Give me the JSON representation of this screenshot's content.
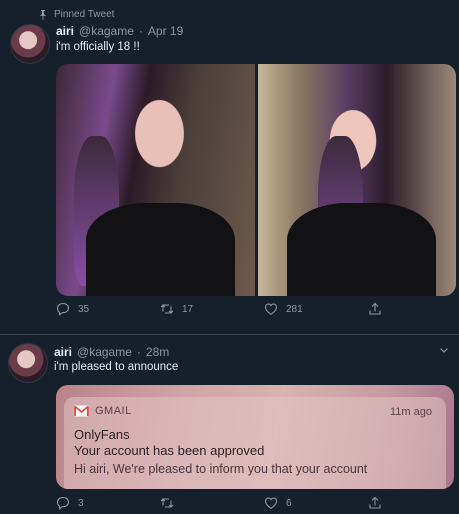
{
  "tweet1": {
    "pinned_label": "Pinned Tweet",
    "name": "airi",
    "handle": "@kagame",
    "time": "Apr 19",
    "text": "i'm officially 18 !!",
    "replies": "35",
    "retweets": "17",
    "likes": "281"
  },
  "tweet2": {
    "name": "airi",
    "handle": "@kagame",
    "time": "28m",
    "text": "i'm pleased to announce",
    "card": {
      "app": "GMAIL",
      "time": "11m ago",
      "title": "OnlyFans",
      "subject": "Your account has been approved",
      "preview": "Hi airi, We're pleased to inform you that your account"
    },
    "replies": "3",
    "retweets": "",
    "likes": "6"
  },
  "separator": "·",
  "colors": {
    "background": "#15202b",
    "muted": "#8899a6",
    "gmail_red": "#ea4335"
  }
}
